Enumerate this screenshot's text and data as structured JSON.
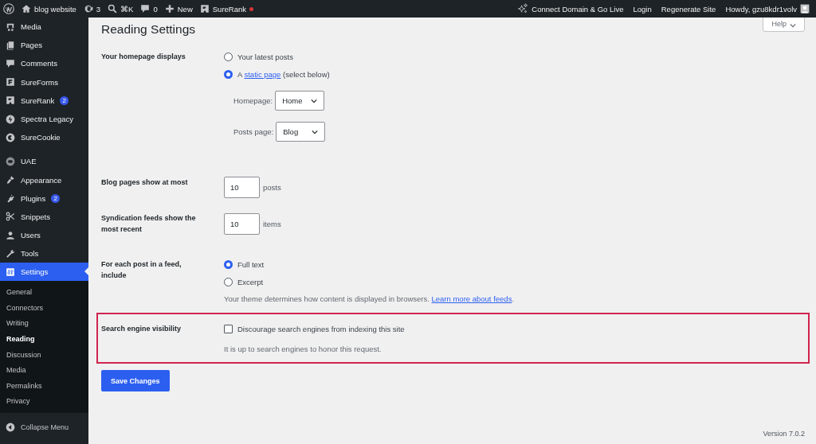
{
  "admin_bar": {
    "left": [
      {
        "kind": "logo"
      },
      {
        "kind": "home",
        "label": "blog website"
      },
      {
        "kind": "updates",
        "label": "3"
      },
      {
        "kind": "search",
        "label": "⌘K"
      },
      {
        "kind": "comments",
        "label": "0"
      },
      {
        "kind": "new",
        "label": "New"
      },
      {
        "kind": "surerank",
        "label": "SureRank",
        "alert": true
      }
    ],
    "right": [
      {
        "kind": "sparkle",
        "label": "Connect Domain & Go Live"
      },
      {
        "kind": "text",
        "label": "Login"
      },
      {
        "kind": "text",
        "label": "Regenerate Site"
      },
      {
        "kind": "account",
        "label": "Howdy, gzu8kdr1volv"
      }
    ]
  },
  "sidebar": {
    "items": [
      {
        "label": "Media",
        "selected": false
      },
      {
        "label": "Pages",
        "selected": false
      },
      {
        "label": "Comments",
        "selected": false
      },
      {
        "label": "SureForms",
        "selected": false
      },
      {
        "label": "SureRank",
        "badge": "2",
        "selected": false
      },
      {
        "label": "Spectra Legacy",
        "selected": false
      },
      {
        "label": "SureCookie",
        "selected": false
      },
      {
        "label": "UAE",
        "selected": false
      },
      {
        "label": "Appearance",
        "selected": false
      },
      {
        "label": "Plugins",
        "badge": "2",
        "selected": false
      },
      {
        "label": "Snippets",
        "selected": false
      },
      {
        "label": "Users",
        "selected": false
      },
      {
        "label": "Tools",
        "selected": false
      },
      {
        "label": "Settings",
        "selected": true
      }
    ],
    "submenu": [
      {
        "label": "General",
        "selected": false
      },
      {
        "label": "Connectors",
        "selected": false
      },
      {
        "label": "Writing",
        "selected": false
      },
      {
        "label": "Reading",
        "selected": true
      },
      {
        "label": "Discussion",
        "selected": false
      },
      {
        "label": "Media",
        "selected": false
      },
      {
        "label": "Permalinks",
        "selected": false
      },
      {
        "label": "Privacy",
        "selected": false
      }
    ],
    "collapse": "Collapse Menu"
  },
  "help_tab": "Help",
  "title": "Reading Settings",
  "sections": [
    {
      "kind": "radio",
      "label": "Your homepage displays",
      "options": [
        {
          "text": "Your latest posts",
          "selected": false
        },
        {
          "prefix": "A ",
          "link": "static page",
          "suffix": " (select below)",
          "selected": true
        }
      ],
      "selects": [
        {
          "label": "Homepage:",
          "value": "Home"
        },
        {
          "label": "Posts page:",
          "value": "Blog"
        }
      ]
    },
    {
      "kind": "number",
      "label": "Blog pages show at most",
      "value": "10",
      "unit": "posts"
    },
    {
      "kind": "number",
      "label": "Syndication feeds show the most recent",
      "value": "10",
      "unit": "items"
    },
    {
      "kind": "radio",
      "label": "For each post in a feed, include",
      "options": [
        {
          "text": "Full text",
          "selected": true
        },
        {
          "text": "Excerpt",
          "selected": false
        }
      ],
      "description": "Your theme determines how content is displayed in browsers.",
      "description_link": "Learn more about feeds",
      "description_end": "."
    },
    {
      "kind": "checkbox",
      "label": "Search engine visibility",
      "highlighted": true,
      "text": "Discourage search engines from indexing this site",
      "checked": false,
      "description": "It is up to search engines to honor this request."
    }
  ],
  "save_button": "Save Changes",
  "version": "Version 7.0.2"
}
